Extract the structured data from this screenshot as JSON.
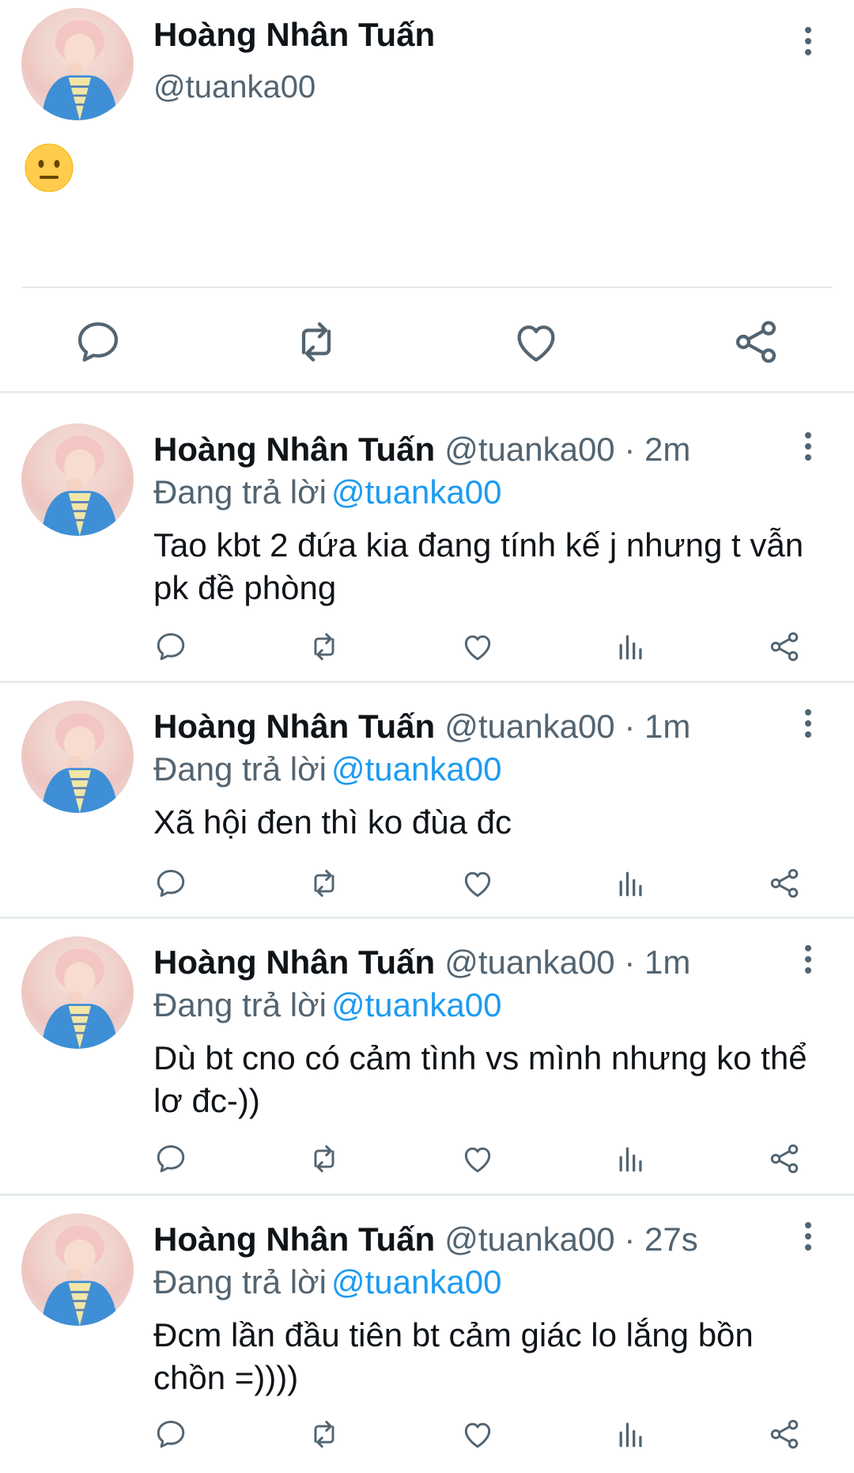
{
  "main_tweet": {
    "name": "Hoàng Nhân Tuấn",
    "handle": "@tuanka00",
    "emoji_icon": "neutral-face-emoji",
    "actions": [
      "reply-icon",
      "retweet-icon",
      "like-icon",
      "share-icon"
    ]
  },
  "replies": [
    {
      "name": "Hoàng Nhân Tuấn",
      "meta": "@tuanka00 · 2m",
      "replying_label": "Đang trả lời",
      "replying_to": "@tuanka00",
      "text": "Tao kbt 2 đứa kia đang tính kế j nhưng t vẫn pk đề phòng"
    },
    {
      "name": "Hoàng Nhân Tuấn",
      "meta": "@tuanka00 · 1m",
      "replying_label": "Đang trả lời",
      "replying_to": "@tuanka00",
      "text": "Xã hội đen thì ko đùa đc"
    },
    {
      "name": "Hoàng Nhân Tuấn",
      "meta": "@tuanka00 · 1m",
      "replying_label": "Đang trả lời",
      "replying_to": "@tuanka00",
      "text": "Dù bt cno có cảm tình vs mình nhưng ko thể lơ đc-))"
    },
    {
      "name": "Hoàng Nhân Tuấn",
      "meta": "@tuanka00 · 27s",
      "replying_label": "Đang trả lời",
      "replying_to": "@tuanka00",
      "text": "Đcm lần đầu tiên bt cảm giác lo lắng bồn chồn =))))"
    }
  ],
  "colors": {
    "text": "#0f1419",
    "secondary": "#536471",
    "mention": "#1d9bf0",
    "divider": "#e6ecf0"
  }
}
